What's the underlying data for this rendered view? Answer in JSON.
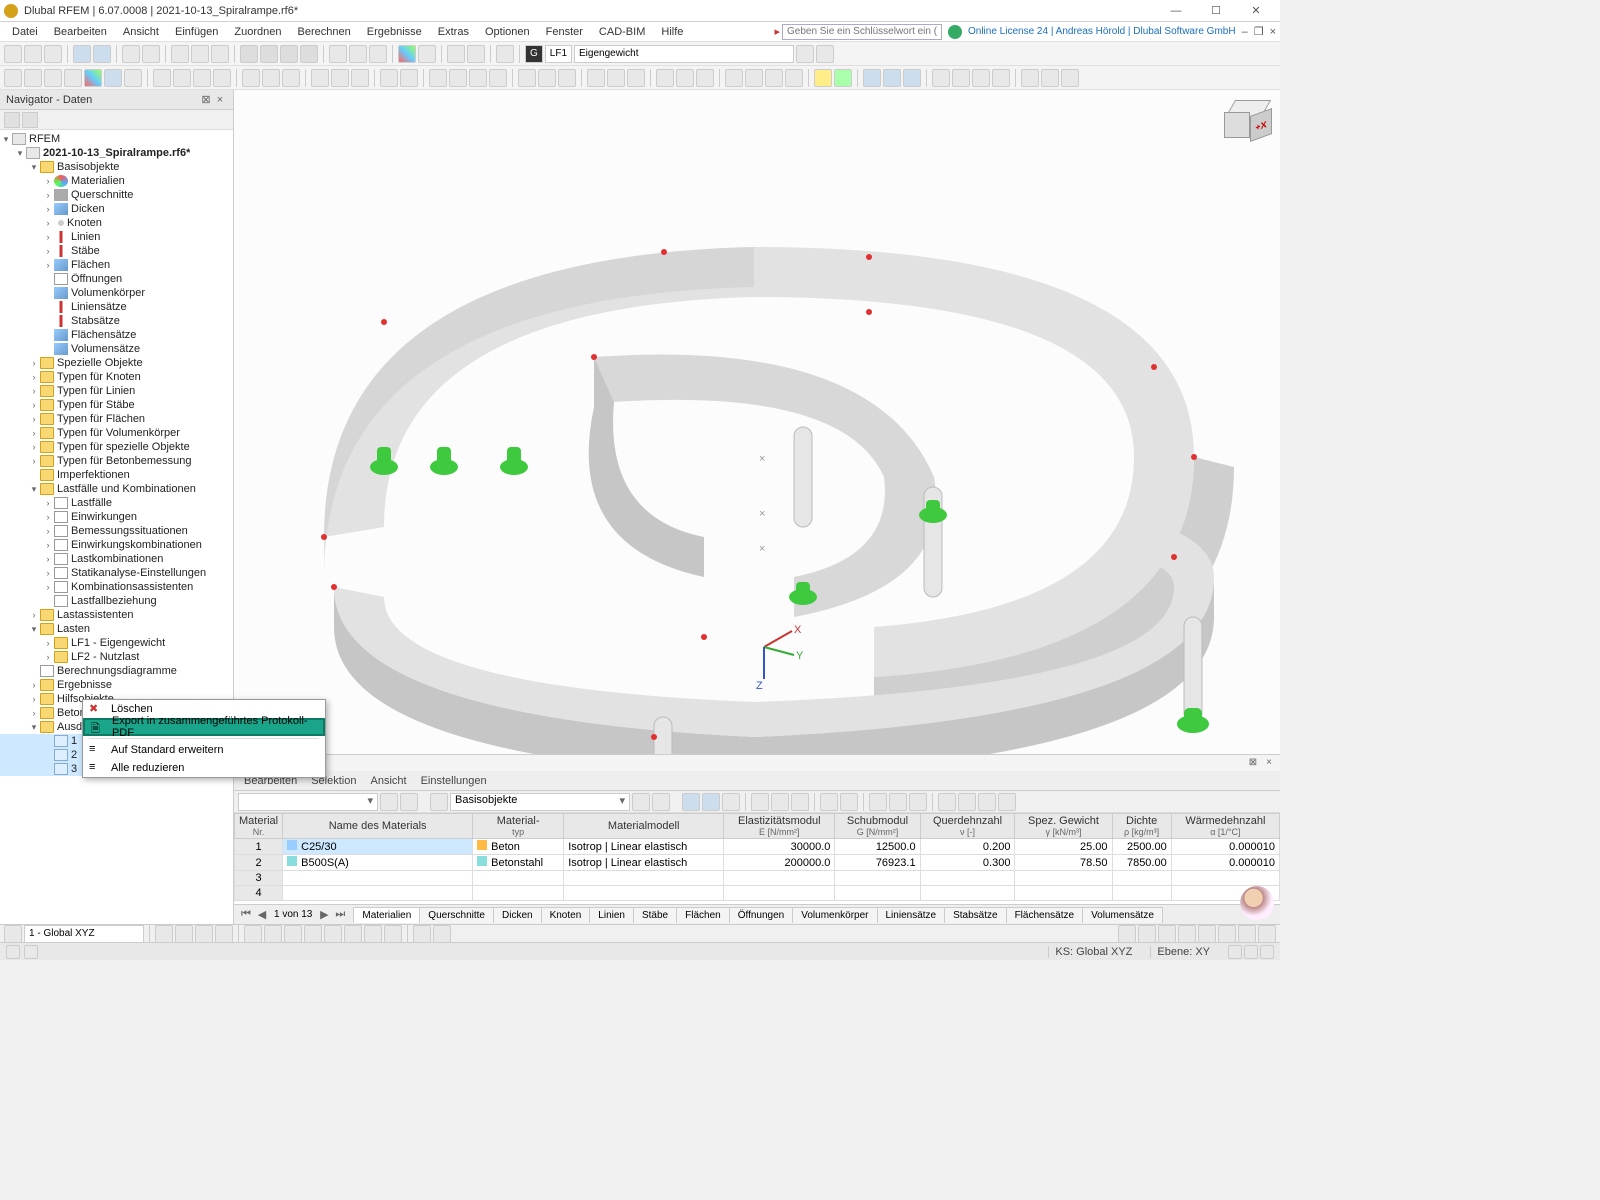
{
  "title": "Dlubal RFEM | 6.07.0008 | 2021-10-13_Spiralrampe.rf6*",
  "menu": [
    "Datei",
    "Bearbeiten",
    "Ansicht",
    "Einfügen",
    "Zuordnen",
    "Berechnen",
    "Ergebnisse",
    "Extras",
    "Optionen",
    "Fenster",
    "CAD-BIM",
    "Hilfe"
  ],
  "search_placeholder": "Geben Sie ein Schlüsselwort ein (Alt...",
  "license_info": "Online License 24 | Andreas Hörold | Dlubal Software GmbH",
  "toolbar_lf": {
    "g": "G",
    "lf": "LF1",
    "lfname": "Eigengewicht"
  },
  "navigator": {
    "title": "Navigator - Daten",
    "root": "RFEM",
    "file": "2021-10-13_Spiralrampe.rf6*",
    "basis": "Basisobjekte",
    "basis_items": [
      "Materialien",
      "Querschnitte",
      "Dicken",
      "Knoten",
      "Linien",
      "Stäbe",
      "Flächen",
      "Öffnungen",
      "Volumenkörper",
      "Liniensätze",
      "Stabsätze",
      "Flächensätze",
      "Volumensätze"
    ],
    "mid_items": [
      "Spezielle Objekte",
      "Typen für Knoten",
      "Typen für Linien",
      "Typen für Stäbe",
      "Typen für Flächen",
      "Typen für Volumenkörper",
      "Typen für spezielle Objekte",
      "Typen für Betonbemessung",
      "Imperfektionen"
    ],
    "lfk": "Lastfälle und Kombinationen",
    "lfk_items": [
      "Lastfälle",
      "Einwirkungen",
      "Bemessungssituationen",
      "Einwirkungskombinationen",
      "Lastkombinationen",
      "Statikanalyse-Einstellungen",
      "Kombinationsassistenten",
      "Lastfallbeziehung"
    ],
    "after_lfk": "Lastassistenten",
    "lasten": "Lasten",
    "lasten_items": [
      "LF1 - Eigengewicht",
      "LF2 - Nutzlast"
    ],
    "tail": [
      "Berechnungsdiagramme",
      "Ergebnisse",
      "Hilfsobjekte",
      "Betonbemessung",
      "Ausdruckprotokolle"
    ],
    "protocols": [
      "1",
      "2",
      "3"
    ]
  },
  "context_menu": {
    "delete": "Löschen",
    "export": "Export in zusammengeführtes Protokoll-PDF",
    "expand": "Auf Standard erweitern",
    "collapse": "Alle reduzieren"
  },
  "cube_label": "+X",
  "axes": {
    "x": "X",
    "y": "Y",
    "z": "Z"
  },
  "table": {
    "menubar": [
      "Bearbeiten",
      "Selektion",
      "Ansicht",
      "Einstellungen"
    ],
    "combo1": "",
    "combo2": "Basisobjekte",
    "headers": [
      {
        "t": "Material",
        "s": "Nr."
      },
      {
        "t": "Name des Materials",
        "s": ""
      },
      {
        "t": "Material-",
        "s": "typ"
      },
      {
        "t": "Materialmodell",
        "s": ""
      },
      {
        "t": "Elastizitätsmodul",
        "s": "E [N/mm²]"
      },
      {
        "t": "Schubmodul",
        "s": "G [N/mm²]"
      },
      {
        "t": "Querdehnzahl",
        "s": "ν [-]"
      },
      {
        "t": "Spez. Gewicht",
        "s": "γ [kN/m³]"
      },
      {
        "t": "Dichte",
        "s": "ρ [kg/m³]"
      },
      {
        "t": "Wärmedehnzahl",
        "s": "α [1/°C]"
      }
    ],
    "rows": [
      {
        "nr": "1",
        "name": "C25/30",
        "typ": "Beton",
        "modell": "Isotrop | Linear elastisch",
        "e": "30000.0",
        "g": "12500.0",
        "nu": "0.200",
        "gamma": "25.00",
        "rho": "2500.00",
        "alpha": "0.000010"
      },
      {
        "nr": "2",
        "name": "B500S(A)",
        "typ": "Betonstahl",
        "modell": "Isotrop | Linear elastisch",
        "e": "200000.0",
        "g": "76923.1",
        "nu": "0.300",
        "gamma": "78.50",
        "rho": "7850.00",
        "alpha": "0.000010"
      },
      {
        "nr": "3"
      },
      {
        "nr": "4"
      }
    ],
    "page": "1 von 13",
    "tabs": [
      "Materialien",
      "Querschnitte",
      "Dicken",
      "Knoten",
      "Linien",
      "Stäbe",
      "Flächen",
      "Öffnungen",
      "Volumenkörper",
      "Liniensätze",
      "Stabsätze",
      "Flächensätze",
      "Volumensätze"
    ]
  },
  "bottom_combo": "1 - Global XYZ",
  "status": {
    "ks": "KS: Global XYZ",
    "ebene": "Ebene: XY"
  }
}
